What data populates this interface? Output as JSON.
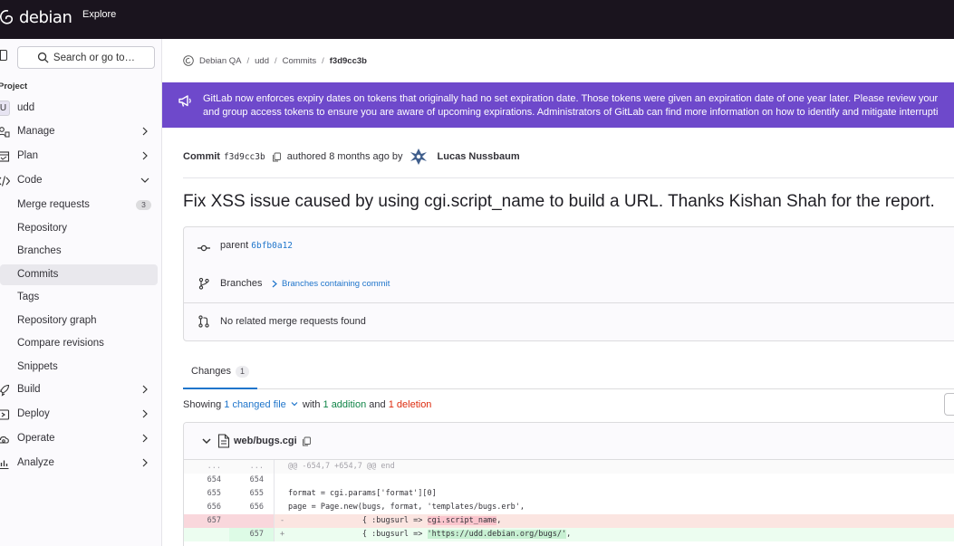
{
  "topbar": {
    "logo_text": "debian",
    "explore": "Explore"
  },
  "sidebar": {
    "search_label": "Search or go to…",
    "project_heading": "Project",
    "project_initial": "U",
    "project_name": "udd",
    "items": [
      {
        "label": "Manage",
        "icon": "users-icon",
        "chevron": "right"
      },
      {
        "label": "Plan",
        "icon": "planning-icon",
        "chevron": "right"
      },
      {
        "label": "Code",
        "icon": "code-icon",
        "chevron": "down"
      },
      {
        "label": "Merge requests",
        "badge": "3"
      },
      {
        "label": "Repository"
      },
      {
        "label": "Branches"
      },
      {
        "label": "Commits",
        "active": true
      },
      {
        "label": "Tags"
      },
      {
        "label": "Repository graph"
      },
      {
        "label": "Compare revisions"
      },
      {
        "label": "Snippets"
      },
      {
        "label": "Build",
        "icon": "rocket-icon",
        "chevron": "right"
      },
      {
        "label": "Deploy",
        "icon": "deploy-icon",
        "chevron": "right"
      },
      {
        "label": "Operate",
        "icon": "cloud-gear-icon",
        "chevron": "right"
      },
      {
        "label": "Analyze",
        "icon": "chart-icon",
        "chevron": "right"
      }
    ]
  },
  "breadcrumb": {
    "items": [
      "Debian QA",
      "udd",
      "Commits",
      "f3d9cc3b"
    ]
  },
  "banner": {
    "line1": "GitLab now enforces expiry dates on tokens that originally had no set expiration date. Those tokens were given an expiration date of one year later. Please review your",
    "line2": "and group access tokens to ensure you are aware of upcoming expirations. Administrators of GitLab can find more information on how to identify and mitigate interrupti"
  },
  "commit": {
    "label": "Commit",
    "sha": "f3d9cc3b",
    "authored": "authored 8 months ago by",
    "author": "Lucas Nussbaum",
    "title": "Fix XSS issue caused by using cgi.script_name to build a URL. Thanks Kishan Shah for the report."
  },
  "info": {
    "parent_label": "parent",
    "parent_sha": "6bfb0a12",
    "branches_label": "Branches",
    "branches_link": "Branches containing commit",
    "mr_text": "No related merge requests found"
  },
  "tabs": {
    "changes_label": "Changes",
    "changes_count": "1"
  },
  "summary": {
    "showing": "Showing",
    "changed_file": "1 changed file",
    "with": "with",
    "additions": "1 addition",
    "and": "and",
    "deletions": "1 deletion"
  },
  "file": {
    "name": "web/bugs.cgi"
  },
  "diff": {
    "hunk": {
      "old": "...",
      "new": "...",
      "code": "@@ -654,7 +654,7 @@ end"
    },
    "lines": [
      {
        "old": "654",
        "new": "654",
        "sign": "",
        "code": ""
      },
      {
        "old": "655",
        "new": "655",
        "sign": "",
        "code": "format = cgi.params['format'][0]"
      },
      {
        "old": "656",
        "new": "656",
        "sign": "",
        "code": "page = Page.new(bugs, format, 'templates/bugs.erb',"
      },
      {
        "old": "657",
        "new": "",
        "sign": "-",
        "code_pre": "                { :bugsurl => ",
        "code_hl": "cgi.script_name",
        "code_post": ","
      },
      {
        "old": "",
        "new": "657",
        "sign": "+",
        "code_pre": "                { :bugsurl => ",
        "code_hl": "'https://udd.debian.org/bugs/'",
        "code_post": ","
      }
    ]
  }
}
